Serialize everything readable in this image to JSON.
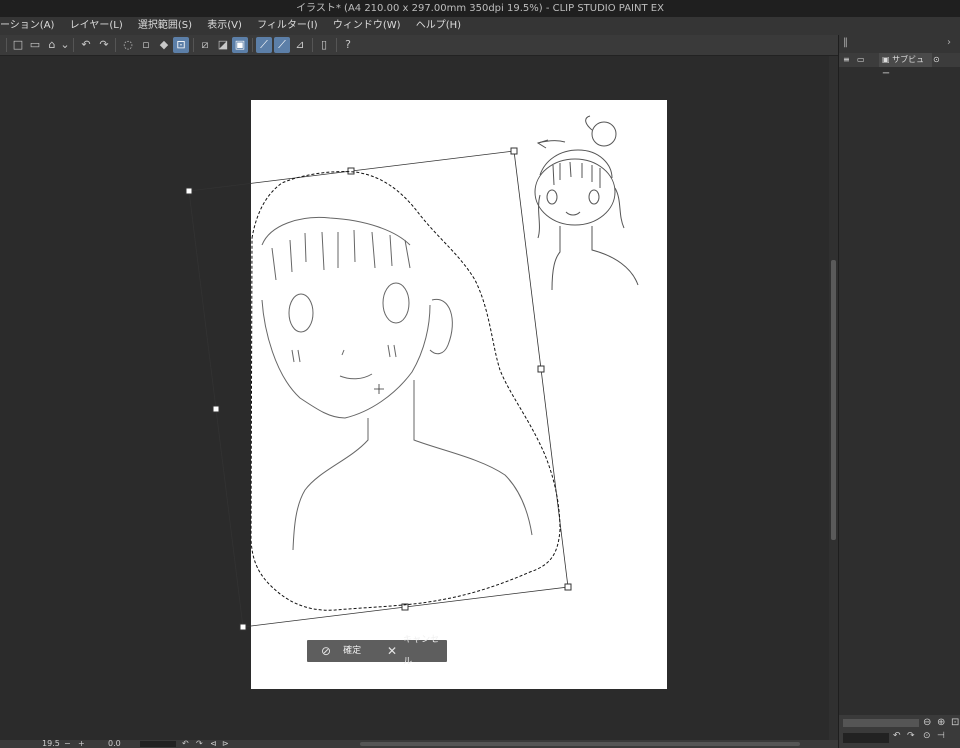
{
  "window": {
    "title": "イラスト* (A4 210.00 x 297.00mm 350dpi 19.5%)  - CLIP STUDIO PAINT EX"
  },
  "menu": {
    "items": [
      "ーション(A)",
      "レイヤー(L)",
      "選択範囲(S)",
      "表示(V)",
      "フィルター(I)",
      "ウィンドウ(W)",
      "ヘルプ(H)"
    ]
  },
  "toolbar": {
    "icons": [
      "new-document-icon",
      "open-file-icon",
      "save-icon",
      "dropdown-icon",
      "undo-icon",
      "redo-icon",
      "clear-icon",
      "fill-icon",
      "transform-icon",
      "deselect-icon",
      "invert-selection-icon",
      "show-selection-icon",
      "snap-ruler-icon",
      "snap-special-ruler-icon",
      "snap-grid-icon",
      "device-icon",
      "help-icon"
    ]
  },
  "right_panel": {
    "tabs": [
      "サブビュー"
    ]
  },
  "transform_bar": {
    "confirm_label": "確定",
    "cancel_label": "キャンセル"
  },
  "status": {
    "zoom_value": "19.5",
    "rotation_value": "0.0"
  },
  "colors": {
    "accent": "#5c7fa8",
    "canvas_bg": "#2b2b2b",
    "paper": "#ffffff"
  }
}
